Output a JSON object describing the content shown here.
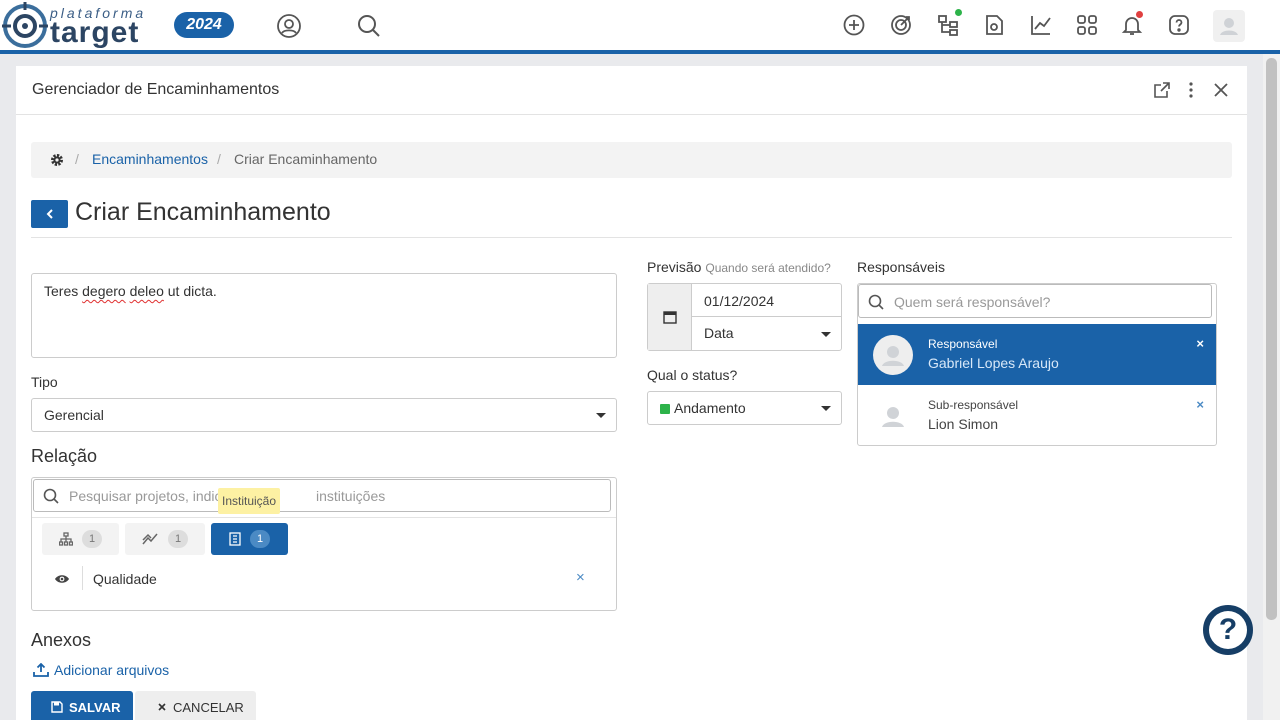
{
  "header": {
    "logo_small": "plataforma",
    "logo_big": "target",
    "year": "2024",
    "icons": [
      "profile-circle-icon",
      "search-icon",
      "add-circle-icon",
      "target-icon",
      "tree-icon",
      "document-icon",
      "chart-line-icon",
      "apps-grid-icon",
      "bell-icon",
      "help-icon",
      "user-avatar-icon"
    ],
    "status_dot_color": "#2db34a",
    "notification_dot_color": "#e04040",
    "accent_color": "#1a62a8"
  },
  "panel": {
    "title": "Gerenciador de Encaminhamentos",
    "icons": [
      "external-link-icon",
      "more-vertical-icon",
      "close-icon"
    ]
  },
  "breadcrumb": {
    "link": "Encaminhamentos",
    "current": "Criar Encaminhamento",
    "separator": "/"
  },
  "page": {
    "title": "Criar Encaminhamento"
  },
  "form": {
    "description_words": [
      "Teres",
      "degero",
      "deleo",
      "ut dicta."
    ],
    "tipo_label": "Tipo",
    "tipo_value": "Gerencial",
    "relacao_title": "Relação",
    "relacao_search_placeholder": "Pesquisar projetos, indic",
    "relacao_search_placeholder_end": "instituições",
    "tabs": [
      {
        "icon": "hierarchy-icon",
        "count": "1"
      },
      {
        "icon": "trend-icon",
        "count": "1"
      },
      {
        "icon": "building-icon",
        "count": "1"
      }
    ],
    "tooltip": "Instituição",
    "relation_item": "Qualidade",
    "remove_mark": "×",
    "previsao_label": "Previsão",
    "previsao_hint": "Quando será atendido?",
    "date_value": "01/12/2024",
    "date_type": "Data",
    "status_label": "Qual o status?",
    "status_value": "Andamento",
    "status_color": "#2db34a",
    "responsaveis_label": "Responsáveis",
    "responsaveis_placeholder": "Quem será responsável?",
    "responsaveis": [
      {
        "role": "Responsável",
        "name": "Gabriel Lopes Araujo"
      },
      {
        "role": "Sub-responsável",
        "name": "Lion Simon"
      }
    ],
    "anexos_title": "Anexos",
    "add_files": "Adicionar arquivos",
    "save": "SALVAR",
    "cancel": "CANCELAR"
  }
}
